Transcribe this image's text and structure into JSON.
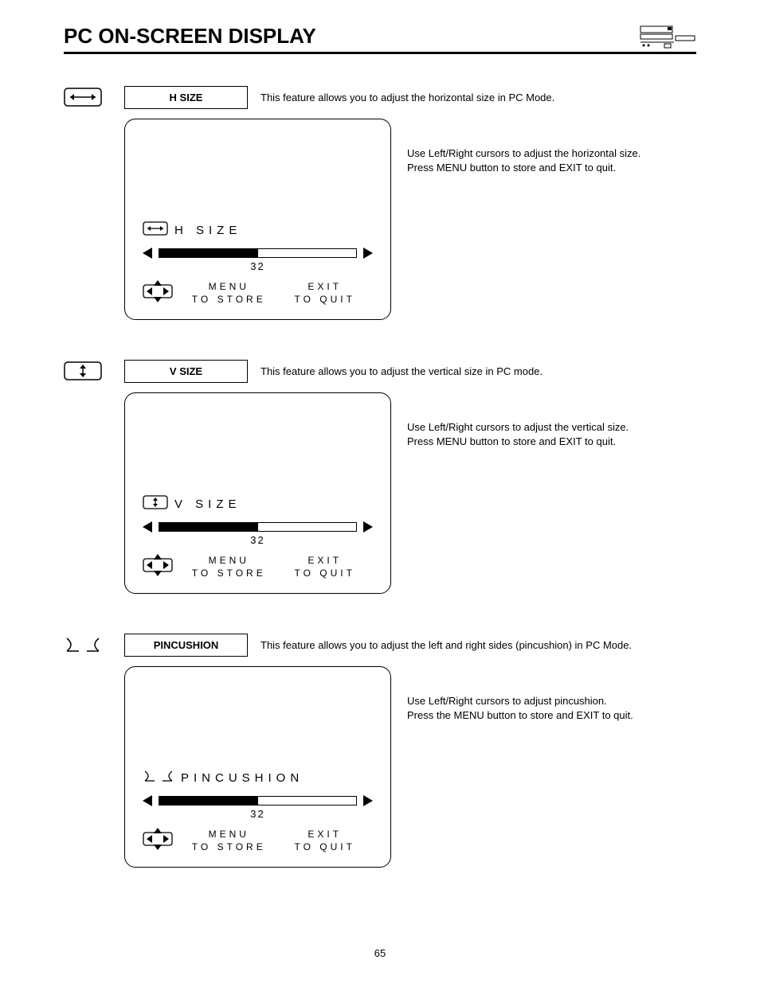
{
  "page_title": "PC ON-SCREEN DISPLAY",
  "page_number": "65",
  "osd_common": {
    "menu_label": "MENU",
    "to_store": "TO STORE",
    "exit_label": "EXIT",
    "to_quit": "TO QUIT"
  },
  "sections": [
    {
      "icon": "hsize",
      "title": "H SIZE",
      "summary": "This feature allows you to adjust the horizontal size in PC Mode.",
      "detail_l1": "Use Left/Right cursors to adjust the horizontal size.",
      "detail_l2": "Press MENU button to store and EXIT to quit.",
      "osd_label": "H SIZE",
      "osd_value": "32"
    },
    {
      "icon": "vsize",
      "title": "V SIZE",
      "summary": "This feature allows you to adjust the vertical size in PC mode.",
      "detail_l1": "Use Left/Right cursors to adjust the vertical size.",
      "detail_l2": "Press MENU button to store and EXIT to quit.",
      "osd_label": "V SIZE",
      "osd_value": "32"
    },
    {
      "icon": "pincushion",
      "title": "PINCUSHION",
      "summary": "This feature allows you to adjust the left and right sides (pincushion) in PC Mode.",
      "detail_l1": "Use Left/Right cursors to adjust pincushion.",
      "detail_l2": "Press the MENU button to store and EXIT to quit.",
      "osd_label": "PINCUSHION",
      "osd_value": "32"
    }
  ]
}
